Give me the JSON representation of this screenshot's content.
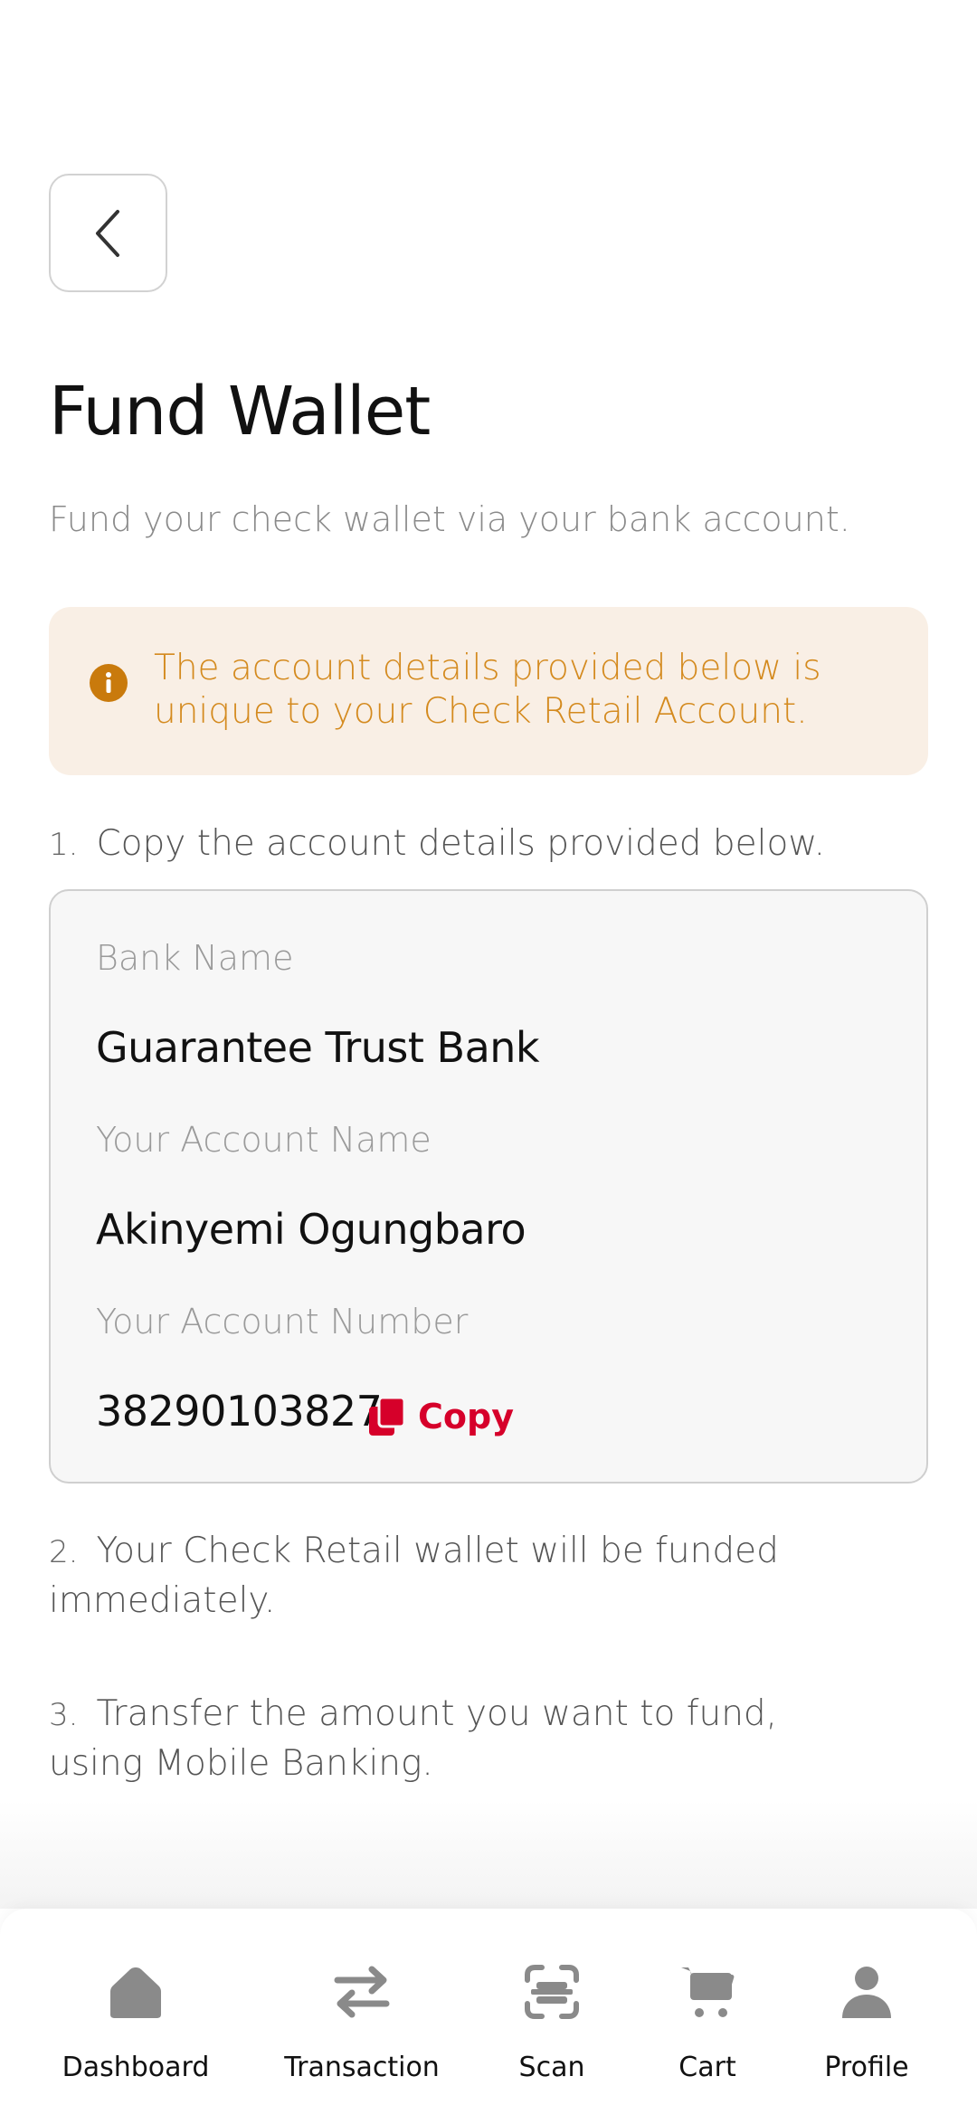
{
  "header": {
    "title": "Fund Wallet",
    "subtitle": "Fund your check wallet via your bank account."
  },
  "notice": {
    "text": "The account details provided below is unique to your Check Retail Account."
  },
  "steps": [
    {
      "number": "1.",
      "text": "Copy the account details provided below."
    },
    {
      "number": "2.",
      "text": "Your Check Retail wallet will be funded immediately."
    },
    {
      "number": "3.",
      "text": "Transfer the amount you want to fund, using Mobile Banking."
    }
  ],
  "account": {
    "bank_name_label": "Bank Name",
    "bank_name": "Guarantee Trust Bank",
    "account_name_label": "Your Account Name",
    "account_name": "Akinyemi Ogungbaro",
    "account_number_label": "Your Account Number",
    "account_number": "38290103827",
    "copy_label": "Copy"
  },
  "nav": {
    "items": [
      {
        "label": "Dashboard",
        "icon": "home-icon"
      },
      {
        "label": "Transaction",
        "icon": "transfer-icon"
      },
      {
        "label": "Scan",
        "icon": "scan-icon"
      },
      {
        "label": "Cart",
        "icon": "cart-icon"
      },
      {
        "label": "Profile",
        "icon": "profile-icon"
      }
    ]
  },
  "colors": {
    "accent": "#d6002a",
    "notice_bg": "#f9efe5",
    "notice_text": "#d48a1e",
    "nav_icon": "#8a8a8a"
  }
}
